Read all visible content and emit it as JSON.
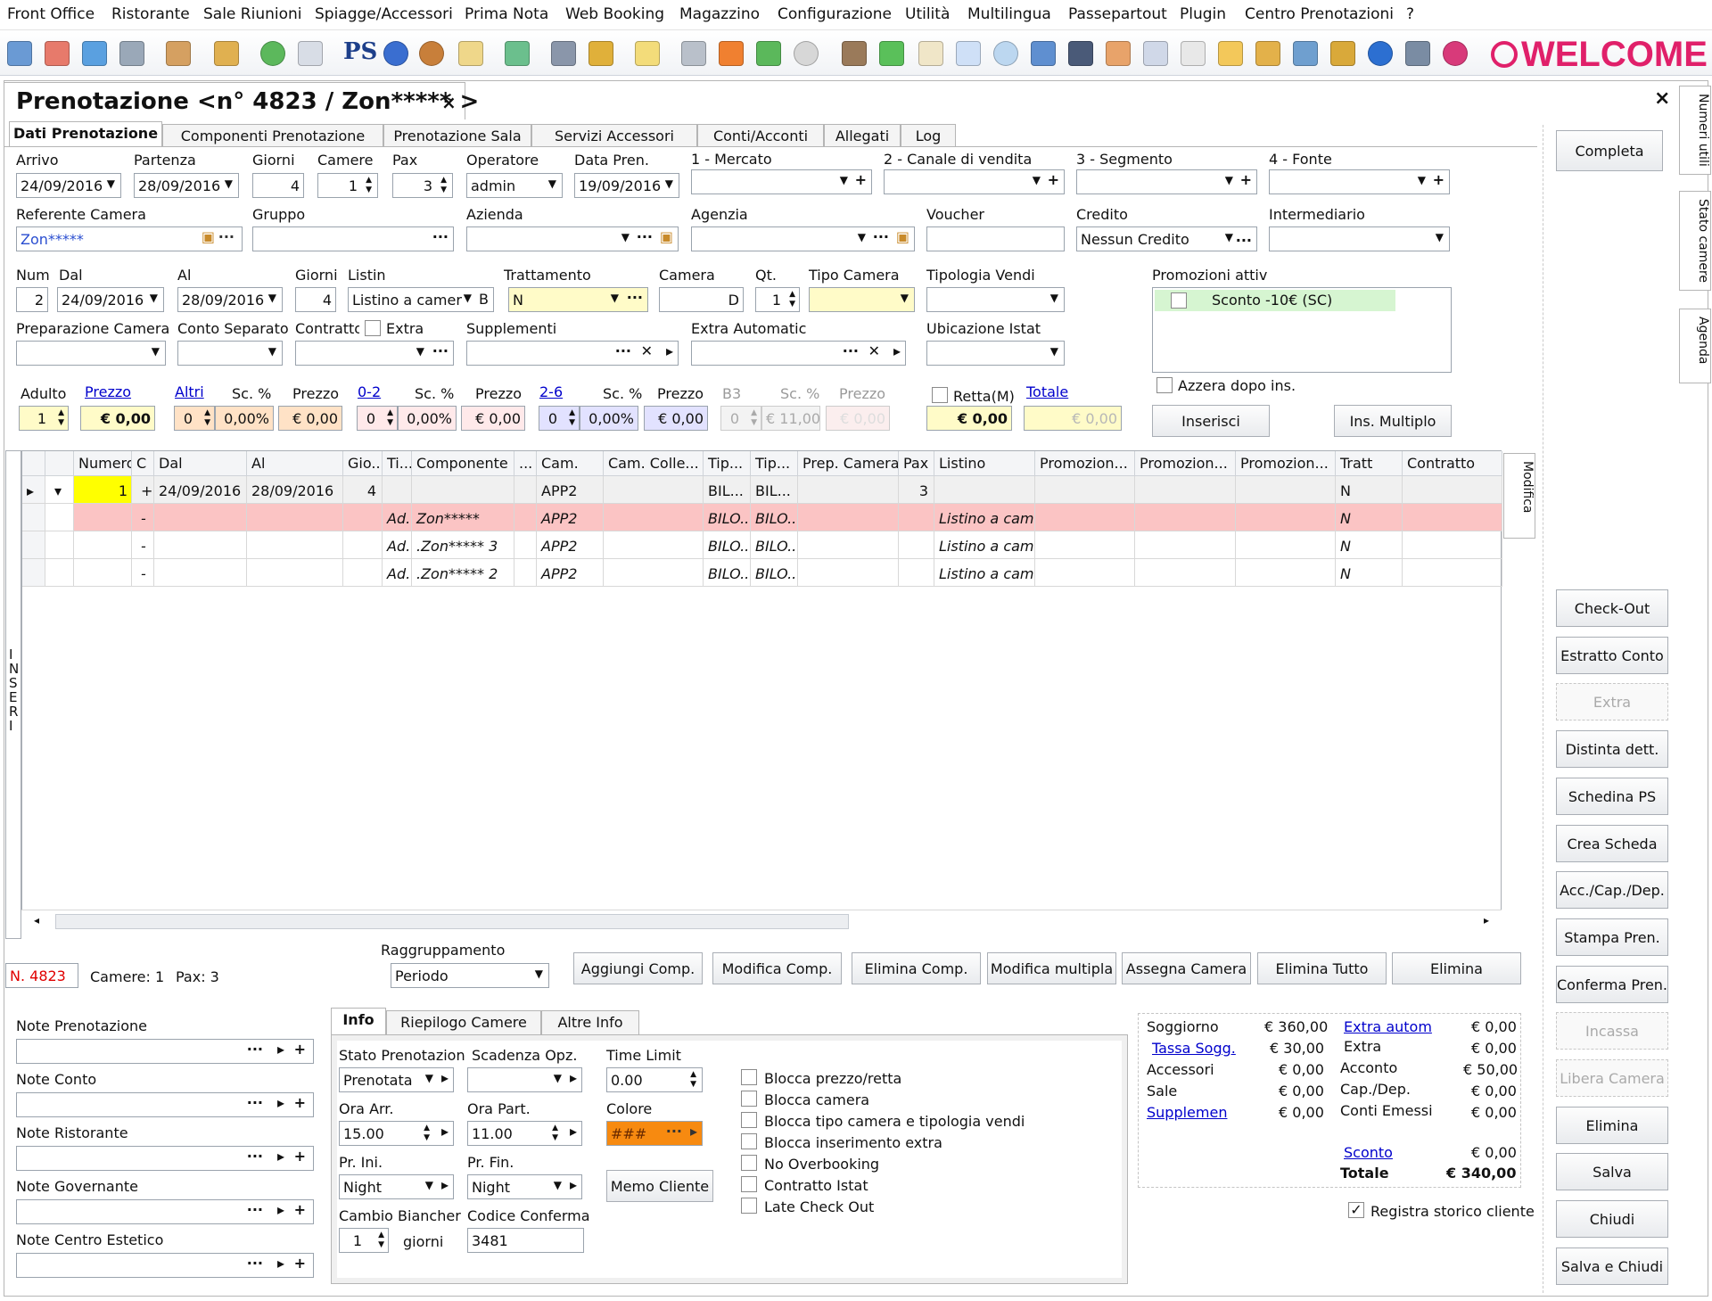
{
  "menu": [
    "Front Office",
    "Ristorante",
    "Sale Riunioni",
    "Spiagge/Accessori",
    "Prima Nota",
    "Web Booking",
    "Magazzino",
    "Configurazione",
    "Utilità",
    "Multilingua",
    "Passepartout",
    "Plugin",
    "Centro Prenotazioni",
    "?"
  ],
  "toolbar": {
    "ps_label": "PS",
    "brand": "WELCOME"
  },
  "doc": {
    "title": "Prenotazione <n° 4823 / Zon***** >",
    "close": "×",
    "window_close": "×"
  },
  "tabs": [
    "Dati Prenotazione",
    "Componenti Prenotazione",
    "Prenotazione Sala",
    "Servizi Accessori",
    "Conti/Acconti",
    "Allegati",
    "Log"
  ],
  "form": {
    "arrivo_l": "Arrivo",
    "arrivo": "24/09/2016",
    "partenza_l": "Partenza",
    "partenza": "28/09/2016",
    "giorni_l": "Giorni",
    "giorni": "4",
    "camere_l": "Camere",
    "camere": "1",
    "pax_l": "Pax",
    "pax": "3",
    "operatore_l": "Operatore",
    "operatore": "admin",
    "datapren_l": "Data Pren.",
    "datapren": "19/09/2016",
    "mercato_l": "1 - Mercato",
    "canale_l": "2 - Canale di vendita",
    "segmento_l": "3 - Segmento",
    "fonte_l": "4 - Fonte",
    "referente_l": "Referente Camera",
    "referente": "Zon*****",
    "gruppo_l": "Gruppo",
    "azienda_l": "Azienda",
    "agenzia_l": "Agenzia",
    "voucher_l": "Voucher",
    "credito_l": "Credito",
    "credito": "Nessun Credito",
    "intermediario_l": "Intermediario",
    "num_l": "Num",
    "num": "2",
    "dal_l": "Dal",
    "dal": "24/09/2016",
    "al_l": "Al",
    "al": "28/09/2016",
    "giorni2_l": "Giorni",
    "giorni2": "4",
    "listino_l": "Listin",
    "listino": "Listino a camer",
    "listino_b": "B",
    "trattamento_l": "Trattamento",
    "trattamento": "N",
    "camera_l": "Camera",
    "camera": "D",
    "qt_l": "Qt.",
    "qt": "1",
    "tipocamera_l": "Tipo Camera",
    "tipologia_l": "Tipologia Vendi",
    "promo_l": "Promozioni attiv",
    "promo_item": "Sconto -10€ (SC)",
    "prep_l": "Preparazione Camera",
    "conto_sep_l": "Conto Separato",
    "contratto_l": "Contratto",
    "extra_l": "Extra",
    "supplementi_l": "Supplementi",
    "extra_auto_l": "Extra Automatic",
    "ubicazione_l": "Ubicazione Istat",
    "azzera_l": "Azzera dopo ins.",
    "adulto_l": "Adulto",
    "prezzo_link": "Prezzo",
    "altri_link": "Altri",
    "sc_l": "Sc. %",
    "prezzo_l": "Prezzo",
    "r02_link": "0-2",
    "r26_link": "2-6",
    "b3_l": "B3",
    "adulto": "1",
    "adulto_prezzo": "€ 0,00",
    "altri": "0",
    "altri_sc": "0,00%",
    "altri_prezzo": "€ 0,00",
    "r02": "0",
    "r02_sc": "0,00%",
    "r02_prezzo": "€ 0,00",
    "r26": "0",
    "r26_sc": "0,00%",
    "r26_prezzo": "€ 0,00",
    "b3": "0",
    "b3_sc": "€ 11,00",
    "b3_prezzo": "€ 0,00",
    "retta_l": "Retta(M)",
    "totale_link": "Totale",
    "retta": "€ 0,00",
    "totale": "€ 0,00",
    "inserisci": "Inserisci",
    "ins_multiplo": "Ins. Multiplo"
  },
  "grid": {
    "headers": [
      "Numero",
      "C",
      "Dal",
      "Al",
      "Gio...",
      "Ti...",
      "Componente",
      "...",
      "Cam.",
      "Cam. Colle...",
      "Tip...",
      "Tip...",
      "Prep. Camera",
      "Pax",
      "Listino",
      "Promozion...",
      "Promozion...",
      "Promozion...",
      "Tratt",
      "Contratto"
    ],
    "rows": [
      [
        "1",
        "+",
        "24/09/2016",
        "28/09/2016",
        "4",
        "",
        "",
        "",
        "APP2",
        "",
        "BIL...",
        "BIL...",
        "",
        "3",
        "",
        "",
        "",
        "",
        "N",
        ""
      ],
      [
        "",
        "-",
        "",
        "",
        "",
        "Ad...",
        "Zon*****",
        "",
        "APP2",
        "",
        "BILO...",
        "BILO...",
        "",
        "",
        "Listino a cam...",
        "",
        "",
        "",
        "N",
        ""
      ],
      [
        "",
        "-",
        "",
        "",
        "",
        "Ad...",
        ".Zon*****  3",
        "",
        "APP2",
        "",
        "BILO...",
        "BILO...",
        "",
        "",
        "Listino a cam...",
        "",
        "",
        "",
        "N",
        ""
      ],
      [
        "",
        "-",
        "",
        "",
        "",
        "Ad...",
        ".Zon*****  2",
        "",
        "APP2",
        "",
        "BILO...",
        "BILO...",
        "",
        "",
        "Listino a cam...",
        "",
        "",
        "",
        "N",
        ""
      ]
    ],
    "side_label": "INSERI",
    "modifica_tab": "Modifica"
  },
  "bottom": {
    "raggr_l": "Raggruppamento",
    "raggr": "Periodo",
    "nres": "N. 4823",
    "camere": "Camere: 1",
    "pax": "Pax: 3",
    "buttons": [
      "Aggiungi Comp.",
      "Modifica Comp.",
      "Elimina Comp.",
      "Modifica multipla",
      "Assegna Camera",
      "Elimina Tutto",
      "Elimina"
    ]
  },
  "notes": [
    "Note Prenotazione",
    "Note Conto",
    "Note Ristorante",
    "Note Governante",
    "Note Centro Estetico"
  ],
  "info": {
    "tabs": [
      "Info",
      "Riepilogo Camere",
      "Altre Info"
    ],
    "stato_l": "Stato Prenotazion",
    "stato": "Prenotata",
    "scad_l": "Scadenza Opz.",
    "timelimit_l": "Time Limit",
    "timelimit": "0.00",
    "oraarr_l": "Ora Arr.",
    "oraarr": "15.00",
    "orapart_l": "Ora Part.",
    "orapart": "11.00",
    "colore_l": "Colore",
    "colore": "###",
    "prini_l": "Pr. Ini.",
    "prini": "Night",
    "prfin_l": "Pr. Fin.",
    "prfin": "Night",
    "memo": "Memo Cliente",
    "cambio_l": "Cambio Biancher",
    "cambio": "1",
    "giorni": "giorni",
    "codice_l": "Codice Conferma",
    "codice": "3481",
    "checks": [
      "Blocca prezzo/retta",
      "Blocca camera",
      "Blocca tipo camera e tipologia vendi",
      "Blocca inserimento extra",
      "No Overbooking",
      "Contratto Istat",
      "Late Check Out"
    ]
  },
  "summary": {
    "soggiorno_l": "Soggiorno",
    "soggiorno": "€ 360,00",
    "tassa_l": "Tassa Sogg.",
    "tassa": "€ 30,00",
    "accessori_l": "Accessori",
    "accessori": "€ 0,00",
    "sale_l": "Sale",
    "sale": "€ 0,00",
    "supplem_l": "Supplemen",
    "supplem": "€ 0,00",
    "extraauto_l": "Extra autom",
    "extraauto": "€ 0,00",
    "extra_l": "Extra",
    "extra": "€ 0,00",
    "acconto_l": "Acconto",
    "acconto": "€ 50,00",
    "cap_l": "Cap./Dep.",
    "cap": "€ 0,00",
    "conti_l": "Conti Emessi",
    "conti": "€ 0,00",
    "sconto_l": "Sconto",
    "sconto": "€ 0,00",
    "totale_l": "Totale",
    "totale": "€ 340,00",
    "registra": "Registra storico cliente"
  },
  "sidebar": {
    "completa": "Completa",
    "buttons": [
      "Check-Out",
      "Estratto Conto",
      "Extra",
      "Distinta dett.",
      "Schedina PS",
      "Crea Scheda",
      "Acc./Cap./Dep.",
      "Stampa Pren.",
      "Conferma Pren.",
      "Incassa",
      "Libera Camera",
      "Elimina",
      "Salva",
      "Chiudi",
      "Salva e Chiudi"
    ],
    "vtabs": [
      "Numeri utili",
      "Stato camere",
      "Agenda"
    ]
  },
  "colors": {
    "accent_brand": "#e0206a",
    "row_selected": "#fbc4c4",
    "number_cell": "#ffff00",
    "colore_field": "#f78a10",
    "nres_red": "#e00000"
  }
}
